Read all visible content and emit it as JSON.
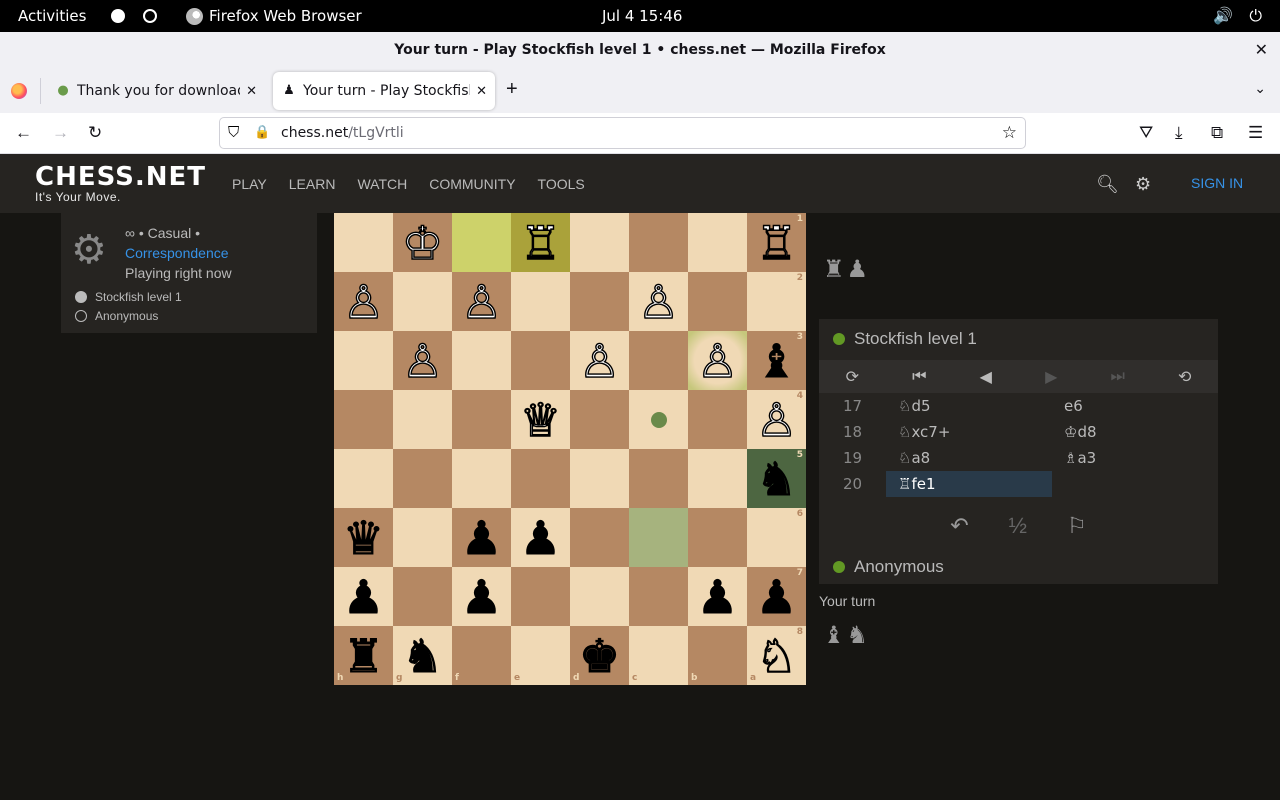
{
  "system": {
    "activities": "Activities",
    "app_name": "Firefox Web Browser",
    "clock": "Jul 4  15:46"
  },
  "window": {
    "title": "Your turn - Play Stockfish level 1 • chess.net — Mozilla Firefox"
  },
  "tabs": [
    {
      "label": "Thank you for downloading"
    },
    {
      "label": "Your turn - Play Stockfish"
    }
  ],
  "address": {
    "domain": "chess.net",
    "path": "/tLgVrtli"
  },
  "site": {
    "logo": "CHESS.NET",
    "tagline": "It's Your Move.",
    "menu": [
      "PLAY",
      "LEARN",
      "WATCH",
      "COMMUNITY",
      "TOOLS"
    ],
    "sign_in": "SIGN IN"
  },
  "game_info": {
    "mode": "∞ • Casual •",
    "type": "Correspondence",
    "status": "Playing right now",
    "players": [
      "Stockfish level 1",
      "Anonymous"
    ]
  },
  "board": {
    "ranks": [
      "1",
      "2",
      "3",
      "4",
      "5",
      "6",
      "7",
      "8"
    ],
    "files": [
      "h",
      "g",
      "f",
      "e",
      "d",
      "c",
      "b",
      "a"
    ],
    "squares": [
      [
        "",
        "♔",
        "",
        "♖",
        "",
        "",
        "",
        "♖"
      ],
      [
        "♙",
        "",
        "♙",
        "",
        "",
        "♙",
        "",
        ""
      ],
      [
        "",
        "♙",
        "",
        "",
        "♙",
        "",
        "♙",
        "♝"
      ],
      [
        "",
        "",
        "",
        "♕",
        "",
        "",
        "",
        "♙"
      ],
      [
        "",
        "",
        "",
        "",
        "",
        "",
        "",
        "♞"
      ],
      [
        "♛",
        "",
        "♟",
        "♟",
        "",
        "",
        "",
        ""
      ],
      [
        "♟",
        "",
        "♟",
        "",
        "",
        "",
        "♟",
        "♟"
      ],
      [
        "♜",
        "♞",
        "",
        "",
        "♚",
        "",
        "",
        "♘"
      ]
    ]
  },
  "captured": {
    "top": "♜♟",
    "bottom": "♝♞"
  },
  "opponent": {
    "name": "Stockfish level 1"
  },
  "player": {
    "name": "Anonymous"
  },
  "moves": [
    {
      "num": "17",
      "white": "♘d5",
      "black": "e6"
    },
    {
      "num": "18",
      "white": "♘xc7+",
      "black": "♔d8"
    },
    {
      "num": "19",
      "white": "♘a8",
      "black": "♗a3"
    },
    {
      "num": "20",
      "white": "♖fe1",
      "black": ""
    }
  ],
  "actions": {
    "draw": "½"
  },
  "turn_status": "Your turn"
}
